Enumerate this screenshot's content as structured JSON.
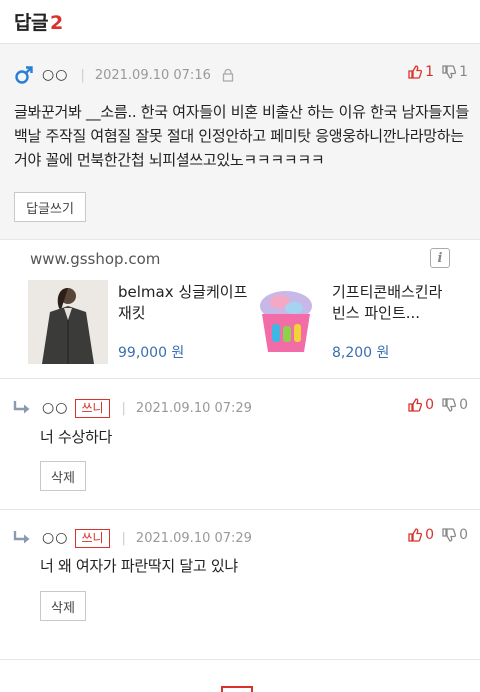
{
  "header": {
    "title": "답글",
    "count": "2"
  },
  "main_comment": {
    "nickname": "○○",
    "date": "2021.09.10 07:16",
    "upvotes": "1",
    "downvotes": "1",
    "text": "글봐꾼거봐 __소름.. 한국 여자들이 비혼 비출산 하는 이유 한국 남자들지들 백날 주작질 여혐질 잘못 절대 인정안하고 페미탓 응앵웅하니깐나라망하는거야 꼴에 먼북한간첩 뇌피셜쓰고있노ㅋㅋㅋㅋㅋㅋ",
    "reply_button": "답글쓰기",
    "colors": {
      "up": "#d9322b",
      "male_icon": "#2a7fd4"
    }
  },
  "ad": {
    "domain": "www.gsshop.com",
    "info_icon": "i",
    "products": [
      {
        "name": "belmax 싱글케이프 재킷",
        "price": "99,000 원",
        "image": "jacket-photo"
      },
      {
        "name": "기프티콘배스킨라빈스 파인트...",
        "price": "8,200 원",
        "image": "icecream-cup-photo"
      }
    ]
  },
  "replies": [
    {
      "nickname": "○○",
      "badge": "쓰니",
      "date": "2021.09.10 07:29",
      "upvotes": "0",
      "downvotes": "0",
      "text": "너 수상하다",
      "delete_button": "삭제"
    },
    {
      "nickname": "○○",
      "badge": "쓰니",
      "date": "2021.09.10 07:29",
      "upvotes": "0",
      "downvotes": "0",
      "text": "너 왜 여자가 파란딱지 달고 있냐",
      "delete_button": "삭제"
    }
  ]
}
